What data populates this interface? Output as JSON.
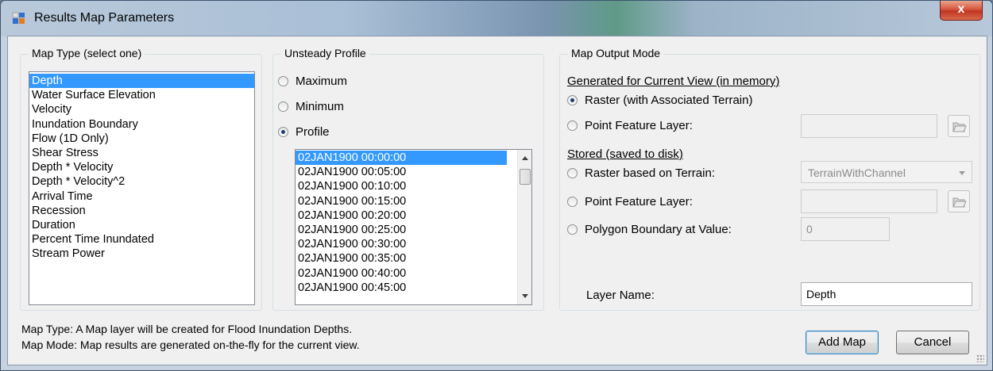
{
  "window": {
    "title": "Results Map Parameters",
    "close_label": "x"
  },
  "map_type": {
    "group_label": "Map Type (select one)",
    "items": [
      "Depth",
      "Water Surface Elevation",
      "Velocity",
      "Inundation Boundary",
      "Flow (1D Only)",
      "Shear Stress",
      "Depth * Velocity",
      "Depth * Velocity^2",
      "Arrival Time",
      "Recession",
      "Duration",
      "Percent Time Inundated",
      "Stream Power"
    ],
    "selected": "Depth"
  },
  "unsteady_profile": {
    "group_label": "Unsteady Profile",
    "options": {
      "maximum": "Maximum",
      "minimum": "Minimum",
      "profile": "Profile"
    },
    "selected_option": "Profile",
    "times": [
      "02JAN1900 00:00:00",
      "02JAN1900 00:05:00",
      "02JAN1900 00:10:00",
      "02JAN1900 00:15:00",
      "02JAN1900 00:20:00",
      "02JAN1900 00:25:00",
      "02JAN1900 00:30:00",
      "02JAN1900 00:35:00",
      "02JAN1900 00:40:00",
      "02JAN1900 00:45:00"
    ],
    "selected_time": "02JAN1900 00:00:00"
  },
  "output_mode": {
    "group_label": "Map Output Mode",
    "generated_heading": "Generated for Current View (in memory)",
    "raster_assoc": "Raster (with Associated Terrain)",
    "point_layer_1": "Point Feature Layer:",
    "point_layer_1_value": "",
    "stored_heading": "Stored (saved to disk)",
    "raster_terrain": "Raster based on Terrain:",
    "terrain_combo_value": "TerrainWithChannel",
    "point_layer_2": "Point Feature Layer:",
    "point_layer_2_value": "",
    "polygon_boundary": "Polygon Boundary at Value:",
    "polygon_value": "0",
    "selected_option": "Raster (with Associated Terrain)",
    "layer_name_label": "Layer Name:",
    "layer_name_value": "Depth"
  },
  "status": {
    "map_type_line": "Map Type: A Map layer will be created for Flood Inundation Depths.",
    "map_mode_line": "Map Mode: Map results are generated on-the-fly for the current view."
  },
  "buttons": {
    "add_map": "Add Map",
    "cancel": "Cancel"
  }
}
